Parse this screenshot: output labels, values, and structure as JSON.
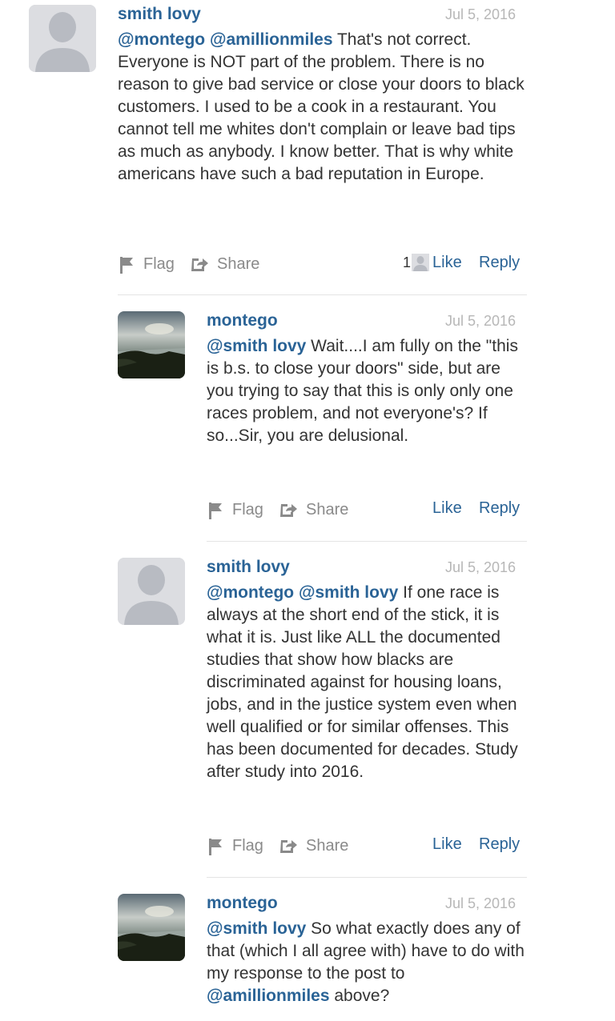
{
  "comments": [
    {
      "author": "smith lovy",
      "date": "Jul 5, 2016",
      "avatar": "default-avatar",
      "segments": [
        {
          "type": "mention",
          "text": "@montego"
        },
        {
          "type": "text",
          "text": " "
        },
        {
          "type": "mention",
          "text": "@amillionmiles"
        },
        {
          "type": "text",
          "text": " That's not correct.  Everyone is NOT part of the problem.  There is no reason to give bad service or close your doors to black customers.  I used to be a cook in a restaurant.  You cannot tell me whites don't complain or leave bad tips as much as anybody.  I know better.  That is why white americans have such a bad reputation in Europe."
        }
      ],
      "flag_label": "Flag",
      "share_label": "Share",
      "like_count": "1",
      "like_label": "Like",
      "reply_label": "Reply"
    },
    {
      "author": "montego",
      "date": "Jul 5, 2016",
      "avatar": "landscape-photo-avatar",
      "segments": [
        {
          "type": "mention",
          "text": "@smith lovy"
        },
        {
          "type": "text",
          "text": " Wait....I am fully on the \"this is b.s. to close your doors\" side, but are you trying to say that this is only only one races problem, and not everyone's?  If so...Sir, you are delusional."
        }
      ],
      "flag_label": "Flag",
      "share_label": "Share",
      "like_label": "Like",
      "reply_label": "Reply"
    },
    {
      "author": "smith lovy",
      "date": "Jul 5, 2016",
      "avatar": "default-avatar",
      "segments": [
        {
          "type": "mention",
          "text": "@montego"
        },
        {
          "type": "text",
          "text": " "
        },
        {
          "type": "mention",
          "text": "@smith lovy"
        },
        {
          "type": "text",
          "text": " If one race is always at the short end of the stick, it is what it is.  Just like ALL the documented studies that show how blacks are discriminated against for housing loans, jobs, and in the justice system even when well qualified or for similar offenses.  This has been documented for decades.  Study after study into 2016."
        }
      ],
      "flag_label": "Flag",
      "share_label": "Share",
      "like_label": "Like",
      "reply_label": "Reply"
    },
    {
      "author": "montego",
      "date": "Jul 5, 2016",
      "avatar": "landscape-photo-avatar",
      "segments": [
        {
          "type": "mention",
          "text": "@smith lovy"
        },
        {
          "type": "text",
          "text": "  So what exactly does any of that (which I all agree with) have to do with my response to the post to "
        },
        {
          "type": "mention",
          "text": "@amillionmiles"
        },
        {
          "type": "text",
          "text": " above?"
        }
      ]
    }
  ],
  "colors": {
    "link": "#2a6396",
    "text": "#333333",
    "muted": "#8a8a8a",
    "date": "#b7b7b7",
    "divider": "#e4e4e4"
  }
}
